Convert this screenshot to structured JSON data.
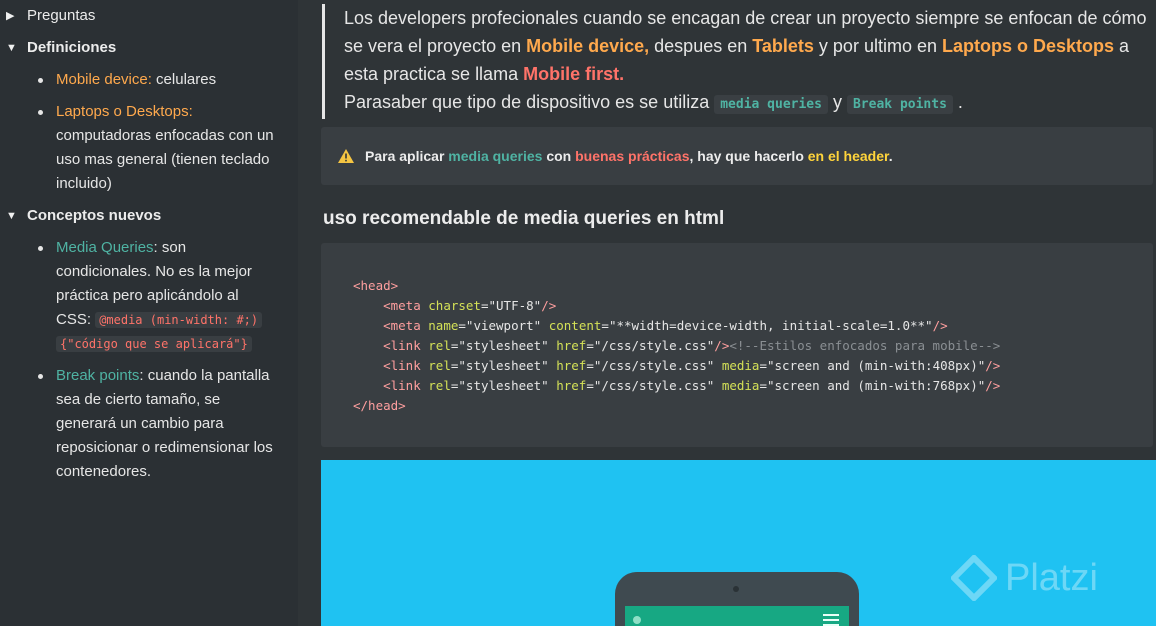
{
  "sidebar": {
    "toggles": {
      "preguntas": "Preguntas",
      "definiciones": "Definiciones",
      "conceptos": "Conceptos nuevos"
    },
    "definiciones": {
      "mobile_label": "Mobile device:",
      "mobile_desc": " celulares",
      "laptops_label": "Laptops o Desktops:",
      "laptops_desc": "computadoras enfocadas con un uso mas general (tienen teclado incluido)"
    },
    "conceptos": {
      "mq_label": "Media Queries",
      "mq_desc": ": son condicionales. No es la mejor práctica pero aplicándolo al CSS: ",
      "mq_code1": "@media (min-width: #;)",
      "mq_code2": "{\"código que se aplicará\"}",
      "bp_label": "Break points",
      "bp_desc": ": cuando la pantalla sea de cierto tamaño, se generará un cambio para reposicionar o redimensionar los contenedores."
    }
  },
  "main": {
    "quote": {
      "p1": "Los developers profecionales  cuando se encagan de crear un proyecto siempre se enfocan de cómo se vera el proyecto en ",
      "mobile": "Mobile device,",
      "p2": " despues en ",
      "tablets": "Tablets",
      "p3": " y por ultimo en ",
      "laptops": "Laptops o Desktops",
      "p4": " a esta practica se llama ",
      "mobilefirst": "Mobile first.",
      "p5": "Parasaber que tipo de dispositivo es se utiliza ",
      "code1": "media queries",
      "p6": " y ",
      "code2": "Break points",
      "p7": " ."
    },
    "callout": {
      "t1": "Para aplicar ",
      "mq": "media queries",
      "t2": " con ",
      "bp": "buenas prácticas",
      "t3": ", hay que hacerlo ",
      "header": "en el header",
      "t4": "."
    },
    "heading": "uso recomendable de media queries en html",
    "code": {
      "open_head": "<head>",
      "close_head": "</head>",
      "meta_charset": "UTF-8",
      "meta_name": "viewport",
      "meta_content": "**width=device-width, initial-scale=1.0**",
      "href": "/css/style.css",
      "comment": "<!--Estilos enfocados para mobile-->",
      "media1": "screen and (min-with:408px)",
      "media2": "screen and (min-with:768px)"
    },
    "watermark": "Platzi"
  }
}
